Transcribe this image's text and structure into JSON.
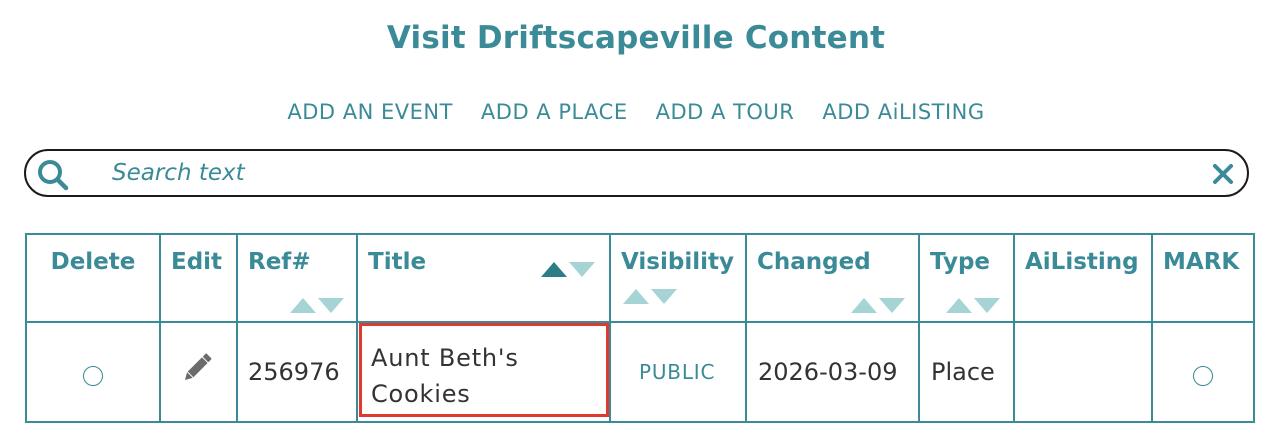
{
  "page": {
    "title": "Visit Driftscapeville Content"
  },
  "nav": {
    "items": [
      {
        "label": "ADD AN EVENT"
      },
      {
        "label": "ADD A PLACE"
      },
      {
        "label": "ADD A TOUR"
      },
      {
        "label": "ADD AiLISTING"
      }
    ]
  },
  "search": {
    "placeholder": "Search text",
    "value": ""
  },
  "table": {
    "headers": {
      "delete": "Delete",
      "edit": "Edit",
      "ref": "Ref#",
      "title": "Title",
      "visibility": "Visibility",
      "changed": "Changed",
      "type": "Type",
      "ailisting": "AiListing",
      "mark": "MARK"
    },
    "sort": {
      "active_column": "title",
      "active_direction": "ascending"
    },
    "rows": [
      {
        "ref": "256976",
        "title": "Aunt Beth's Cookies",
        "visibility": "PUBLIC",
        "changed": "2026-03-09",
        "type": "Place",
        "ailisting": "",
        "delete_selected": false,
        "mark_selected": false
      }
    ]
  },
  "colors": {
    "accent": "#3a8a97",
    "sort_inactive": "#a6d3d4",
    "sort_active": "#2d7d89",
    "highlight_border": "#e03a2f",
    "text": "#333333"
  },
  "icons": {
    "search": "search-icon",
    "clear": "close-icon",
    "edit": "pencil-icon"
  }
}
